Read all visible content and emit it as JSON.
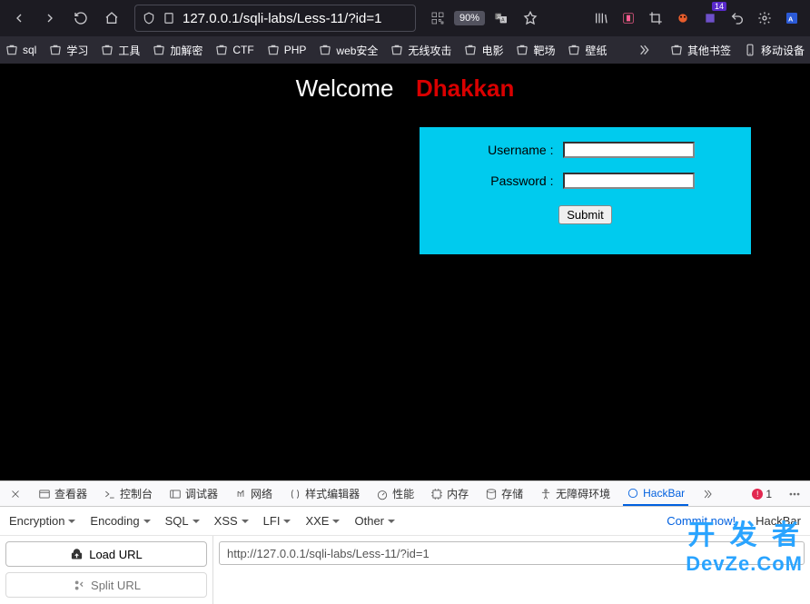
{
  "browser": {
    "url_display": "127.0.0.1/sqli-labs/Less-11/?id=1",
    "zoom": "90%",
    "badge": "14"
  },
  "bookmarks": {
    "items": [
      "sql",
      "学习",
      "工具",
      "加解密",
      "CTF",
      "PHP",
      "web安全",
      "无线攻击",
      "电影",
      "靶场",
      "壁纸"
    ],
    "other": "其他书签",
    "mobile": "移动设备"
  },
  "page": {
    "welcome": "Welcome",
    "name": "Dhakkan",
    "username_label": "Username :",
    "password_label": "Password :",
    "submit": "Submit"
  },
  "devtools": {
    "tabs": [
      "查看器",
      "控制台",
      "调试器",
      "网络",
      "样式编辑器",
      "性能",
      "内存",
      "存储",
      "无障碍环境",
      "HackBar"
    ],
    "error_count": "1"
  },
  "hackbar": {
    "menus": [
      "Encryption",
      "Encoding",
      "SQL",
      "XSS",
      "LFI",
      "XXE",
      "Other"
    ],
    "commit": "Commit now!",
    "brand": "HackBar",
    "load_url": "Load URL",
    "split_url": "Split URL",
    "url_value": "http://127.0.0.1/sqli-labs/Less-11/?id=1"
  },
  "watermark": {
    "l1": "开 发 者",
    "l2": "DevZe.CoM"
  }
}
